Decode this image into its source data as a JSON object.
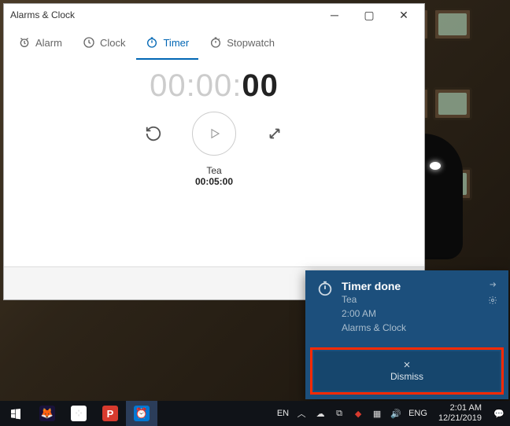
{
  "window": {
    "title": "Alarms & Clock",
    "tabs": [
      {
        "label": "Alarm",
        "active": false
      },
      {
        "label": "Clock",
        "active": false
      },
      {
        "label": "Timer",
        "active": true
      },
      {
        "label": "Stopwatch",
        "active": false
      }
    ],
    "timer": {
      "display_dim": "00:00:",
      "display_bold": "00",
      "name": "Tea",
      "duration": "00:05:00"
    },
    "add_label": "+"
  },
  "notification": {
    "title": "Timer done",
    "line1": "Tea",
    "line2": "2:00 AM",
    "source": "Alarms & Clock",
    "dismiss": "Dismiss"
  },
  "taskbar": {
    "ime": "EN",
    "lang": "ENG",
    "time": "2:01 AM",
    "date": "12/21/2019"
  }
}
